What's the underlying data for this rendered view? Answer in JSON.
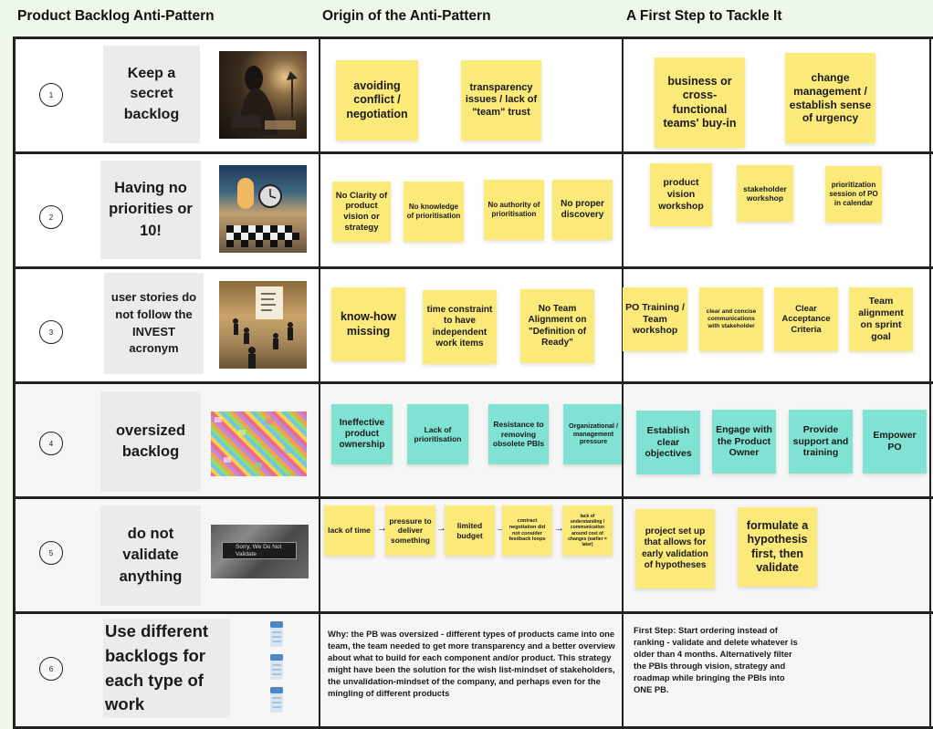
{
  "headers": {
    "col1": "Product Backlog Anti-Pattern",
    "col2": "Origin of the Anti-Pattern",
    "col3": "A First Step to Tackle It"
  },
  "colors": {
    "sticky_yellow": "#fbe97a",
    "sticky_teal": "#7fe2d3",
    "background": "#eef8ea"
  },
  "rows": [
    {
      "number": "1",
      "title": "Keep a secret backlog",
      "image": "person-writing-secretly-dim-room",
      "origins": [
        "avoiding conflict / negotiation",
        "transparency issues / lack of \"team\" trust"
      ],
      "steps": [
        "business or cross-functional teams' buy-in",
        "change management / establish sense of urgency"
      ]
    },
    {
      "number": "2",
      "title": "Having no priorities or 10!",
      "image": "surreal-room-clock-checkerboard",
      "origins": [
        "No Clarity of product vision or strategy",
        "No knowledge of prioritisation",
        "No authority of prioritisation",
        "No proper discovery"
      ],
      "steps": [
        "product vision workshop",
        "stakeholder workshop",
        "prioritization session of PO in calendar"
      ]
    },
    {
      "number": "3",
      "title": "user stories do not follow the INVEST acronym",
      "image": "team-meeting-invest-board",
      "origins": [
        "know-how missing",
        "time constraint to have independent work items",
        "No Team Alignment on \"Definition of Ready\""
      ],
      "steps": [
        "PO Training / Team workshop",
        "clear and concise communications with stakeholder",
        "Clear Acceptance Criteria",
        "Team alignment on sprint goal"
      ]
    },
    {
      "number": "4",
      "title": "oversized backlog",
      "image": "wall-of-colorful-sticky-notes",
      "origins": [
        "Ineffective product ownership",
        "Lack of prioritisation",
        "Resistance to removing obsolete PBIs",
        "Organizational / management pressure"
      ],
      "steps": [
        "Establish clear objectives",
        "Engage with the Product Owner",
        "Provide support and training",
        "Empower PO"
      ]
    },
    {
      "number": "5",
      "title": "do not validate anything",
      "image": "sign-sorry-we-do-not-validate",
      "image_caption": "Sorry, We Do Not Validate",
      "origins": [
        "lack of time",
        "pressure to deliver something",
        "limited budget",
        "contract negotiation did not consider feedback loops",
        "lack of understanding / communication around cost of changes (earlier = later)"
      ],
      "steps": [
        "project set up that allows for early validation of hypotheses",
        "formulate a hypothesis first, then validate"
      ]
    },
    {
      "number": "6",
      "title": "Use different backlogs for each type of work",
      "image": "three-database-icons",
      "origin_text": "Why: the PB was oversized - different types of products came into one team, the team needed to get more transparency and a better overview about what to build for each component and/or product. This strategy might have been the solution for the wish list-mindset of stakeholders, the unvalidation-mindset of the company, and perhaps even for the mingling of different products",
      "step_text": "First Step: Start ordering instead of ranking - validate and delete whatever is older than 4 months. Alternatively filter the PBIs through vision, strategy and roadmap while bringing the PBIs into ONE PB."
    }
  ]
}
